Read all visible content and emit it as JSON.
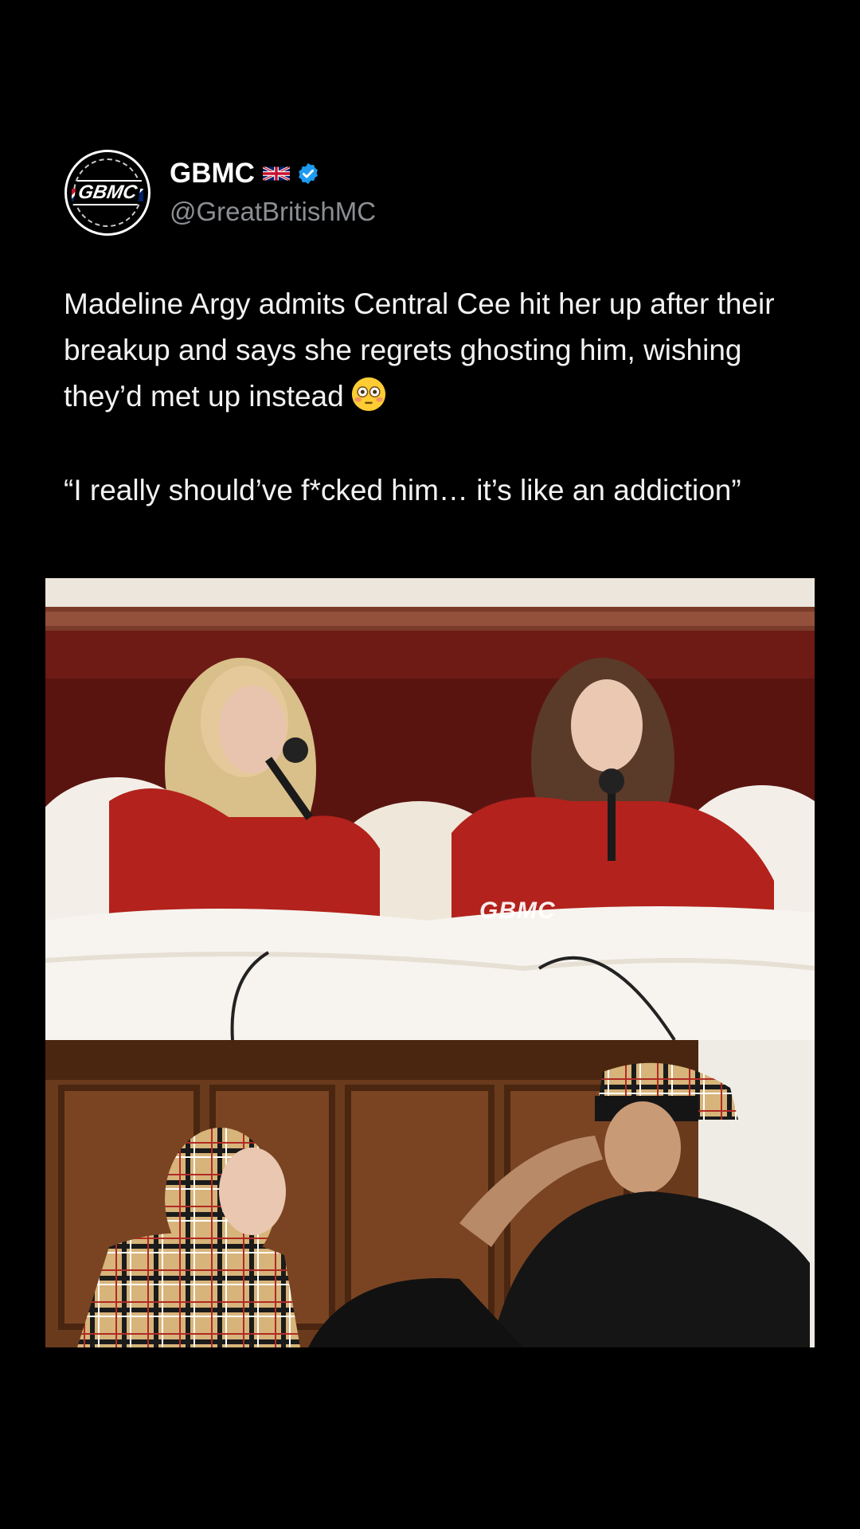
{
  "account": {
    "display_name": "GBMC",
    "handle": "@GreatBritishMC",
    "avatar_wordmark": "GBMC",
    "flag_icon": "uk-flag-icon",
    "verified_icon": "verified-badge-icon",
    "verified_color": "#1d9bf0"
  },
  "post": {
    "text": "Madeline Argy admits Central Cee hit her up after their breakup and says she regrets ghosting him, wishing they’d met up instead",
    "emoji_icon": "flushed-face-emoji",
    "quote": "“I really should’ve f*cked him… it’s like an addiction”"
  },
  "media": {
    "top_image_watermark": "GBMC",
    "top_image_description_icon": "podcast-in-bed-photo",
    "bottom_image_description_icon": "couple-in-burberry-photo"
  },
  "theme": {
    "background": "#000000",
    "text": "#f2f2f2",
    "handle": "#8b8f94"
  }
}
